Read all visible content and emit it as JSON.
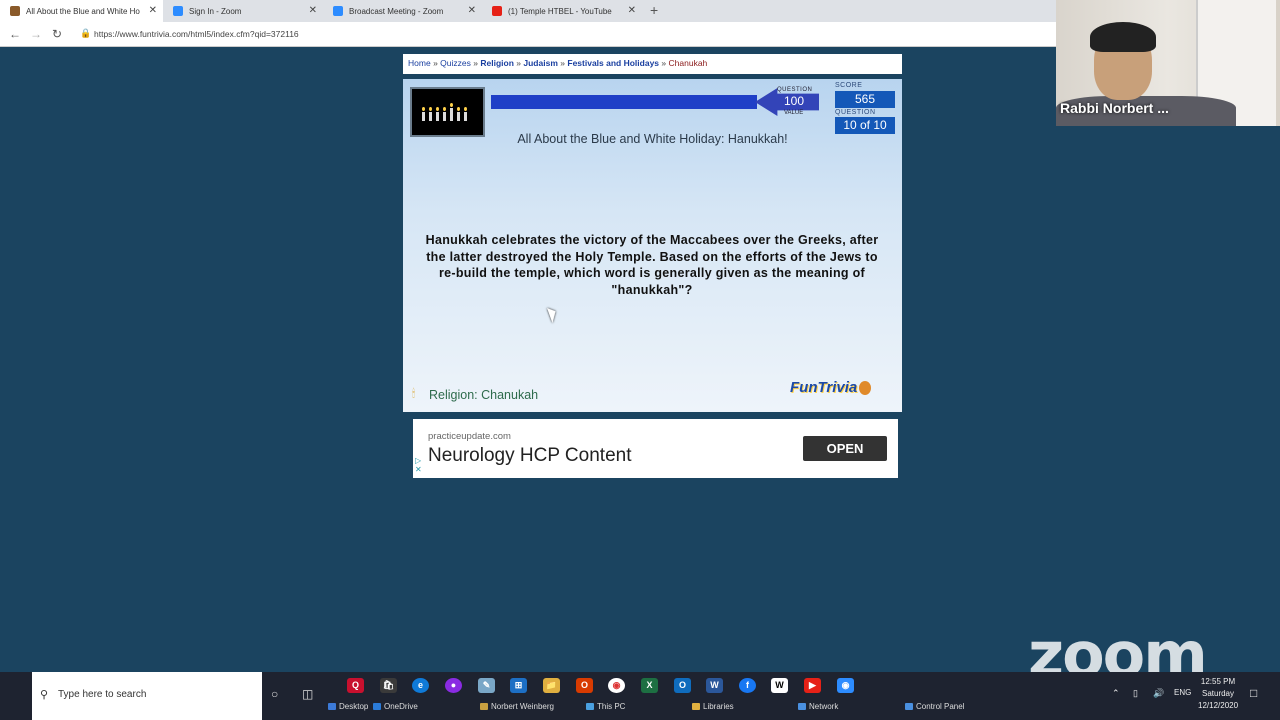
{
  "browser": {
    "tabs": [
      {
        "title": "All About the Blue and White Ho",
        "color": "#8a5a2a"
      },
      {
        "title": "Sign In - Zoom",
        "color": "#2d8cff"
      },
      {
        "title": "Broadcast Meeting - Zoom",
        "color": "#2d8cff"
      },
      {
        "title": "(1) Temple HTBEL - YouTube",
        "color": "#e62117"
      }
    ],
    "close_glyph": "✕",
    "new_tab": "+",
    "url": "https://www.funtrivia.com/html5/index.cfm?qid=372116",
    "icons": {
      "back": "arrow-left-icon",
      "forward": "arrow-right-icon",
      "reload": "reload-icon",
      "lock": "lock-icon"
    }
  },
  "breadcrumb": {
    "items": [
      "Home",
      "Quizzes",
      "Religion",
      "Judaism",
      "Festivals and Holidays",
      "Chanukah"
    ],
    "separator": "»"
  },
  "quiz": {
    "question_label": "QUESTION",
    "question_value": "100",
    "value_label": "VALUE",
    "score_label": "SCORE",
    "score": "565",
    "question_count_label": "QUESTION",
    "question_count": "10 of 10",
    "progress": 1.0,
    "title": "All About the Blue and White Holiday: Hanukkah!",
    "question_text": "Hanukkah celebrates the victory of the Maccabees over the Greeks, after the latter destroyed the Holy Temple. Based on the efforts of the Jews to re-build the temple, which word is generally given as the meaning of \"hanukkah\"?",
    "category": "Religion: Chanukah",
    "logo": "FunTrivia"
  },
  "ad": {
    "domain": "practiceupdate.com",
    "headline": "Neurology HCP Content",
    "cta": "OPEN"
  },
  "video": {
    "participant_name": "Rabbi Norbert ..."
  },
  "zoom_watermark": "zoom",
  "taskbar": {
    "search_placeholder": "Type here to search",
    "quicklinks": [
      {
        "label": "Desktop",
        "color": "#3c7ad8"
      },
      {
        "label": "OneDrive",
        "color": "#2b7bd8"
      },
      {
        "label": "Norbert Weinberg",
        "color": "#c8a040"
      },
      {
        "label": "This PC",
        "color": "#4aa0e0"
      },
      {
        "label": "Libraries",
        "color": "#e0b040"
      },
      {
        "label": "Network",
        "color": "#4a90e0"
      },
      {
        "label": "Control Panel",
        "color": "#4a90e0"
      }
    ],
    "lang": "ENG",
    "time": "12:55 PM",
    "day": "Saturday",
    "date": "12/12/2020"
  }
}
